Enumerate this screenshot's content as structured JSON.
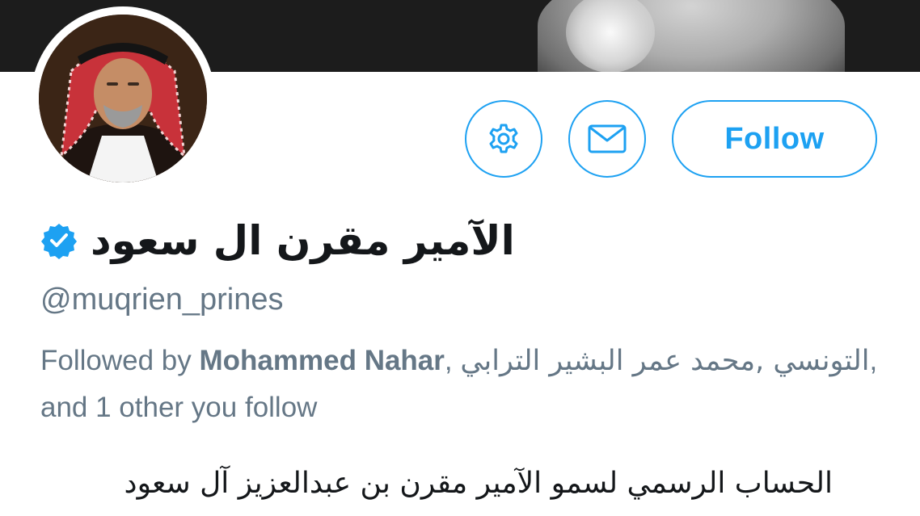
{
  "profile": {
    "display_name": "الآمير مقرن ال سعود",
    "handle": "@muqrien_prines",
    "verified": true,
    "bio": "الحساب الرسمي لسمو الآمير مقرن بن عبدالعزيز آل سعود"
  },
  "followed_by": {
    "prefix": "Followed by",
    "name_1": "Mohammed Nahar",
    "separator_1": ",",
    "name_2": "محمد عمر البشير الترابي",
    "separator_2": ",",
    "name_3": "التونسي",
    "suffix": ", and 1 other you follow"
  },
  "actions": {
    "settings_icon": "gear-icon",
    "message_icon": "envelope-icon",
    "follow_label": "Follow"
  },
  "colors": {
    "accent": "#1da1f2",
    "text_primary": "#14171a",
    "text_secondary": "#657786",
    "banner": "#1c1c1c"
  }
}
